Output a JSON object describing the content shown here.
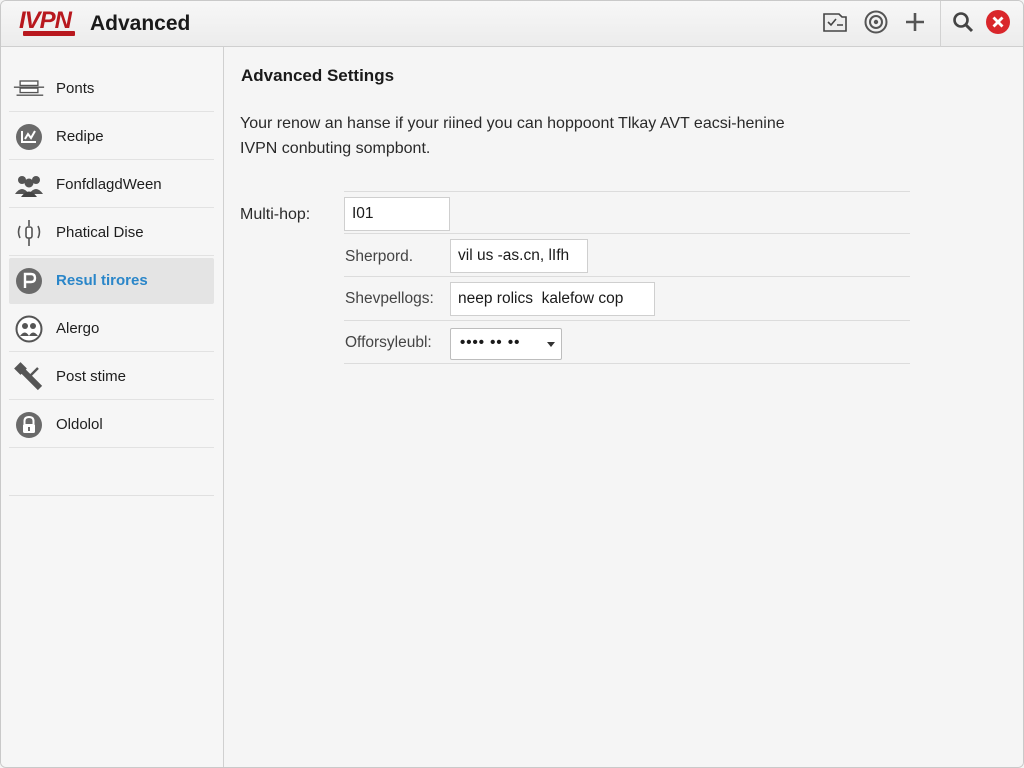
{
  "titlebar": {
    "logo_text": "IVPN",
    "title": "Advanced",
    "buttons": [
      {
        "name": "inbox-icon"
      },
      {
        "name": "target-icon"
      },
      {
        "name": "plus-icon"
      },
      {
        "name": "search-icon"
      },
      {
        "name": "close-icon"
      }
    ]
  },
  "sidebar": {
    "items": [
      {
        "label": "Ponts",
        "icon": "ports-icon",
        "active": false
      },
      {
        "label": "Redipe",
        "icon": "chart-icon",
        "active": false
      },
      {
        "label": "FonfdlagdWeen",
        "icon": "users-icon",
        "active": false
      },
      {
        "label": "Phatical Dise",
        "icon": "antenna-icon",
        "active": false
      },
      {
        "label": "Resul tirores",
        "icon": "p-icon",
        "active": true
      },
      {
        "label": "Alergo",
        "icon": "people-icon",
        "active": false
      },
      {
        "label": "Post stime",
        "icon": "tools-icon",
        "active": false
      },
      {
        "label": "Oldolol",
        "icon": "lock-icon",
        "active": false
      }
    ]
  },
  "main": {
    "section_title": "Advanced Settings",
    "description_lines": [
      "Your renow an hanse if your riined you can hoppoont Tlkay AVT eacsi-henine",
      "IVPN conbuting sompbont."
    ],
    "multihop": {
      "label": "Multi-hop:",
      "value": "I01"
    },
    "fields": [
      {
        "label": "Sherpord.",
        "value": "vil us -as.cn, lIfh"
      },
      {
        "label": "Shevpellogs:",
        "value": "neep rolics  kalefow cop"
      },
      {
        "label": "Offorsyleubl:",
        "value": "•••• •• ••"
      }
    ]
  },
  "colors": {
    "brand": "#b8181e",
    "accent": "#2a86c9",
    "close": "#d9262b"
  }
}
